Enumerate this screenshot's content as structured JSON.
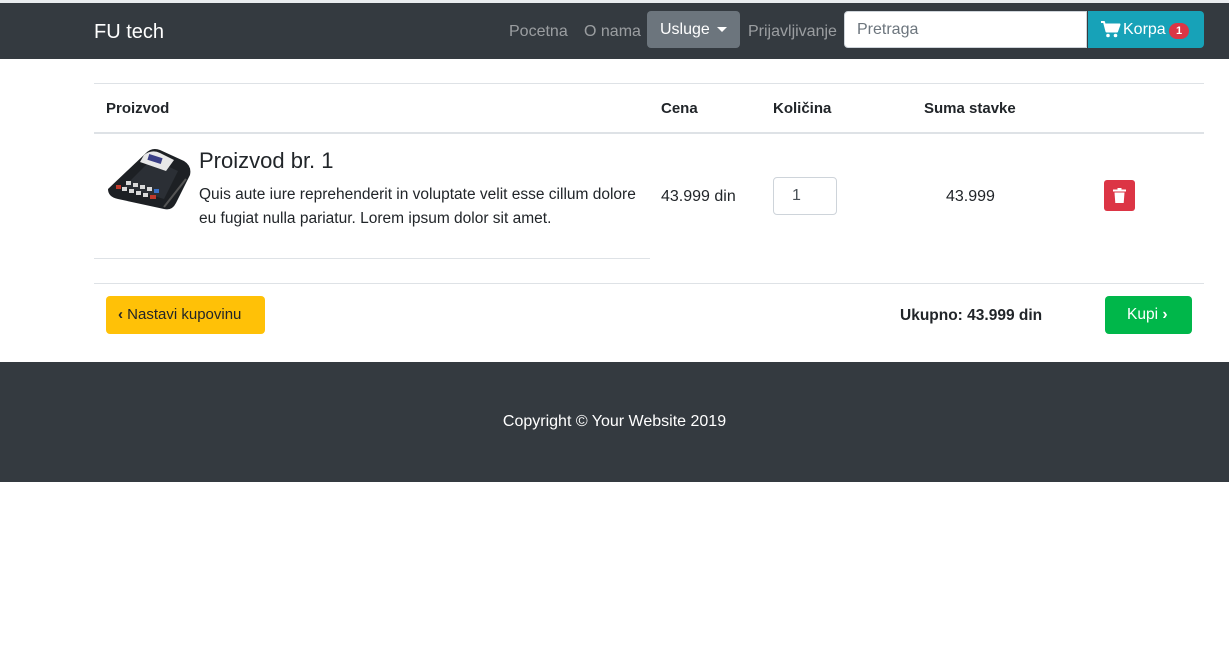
{
  "navbar": {
    "brand": "FU tech",
    "links": [
      "Pocetna",
      "O nama",
      "Usluge",
      "Prijavljivanje"
    ],
    "search_placeholder": "Pretraga",
    "cart_label": "Korpa",
    "cart_count": "1",
    "colors": {
      "bg": "#343a40",
      "dropdown": "#6c757d",
      "cart": "#17a2b8",
      "badge": "#dc3545"
    }
  },
  "table": {
    "headers": [
      "Proizvod",
      "Cena",
      "Količina",
      "Suma stavke"
    ],
    "rows": [
      {
        "title": "Proizvod br. 1",
        "description": "Quis aute iure reprehenderit in voluptate velit esse cillum dolore eu fugiat nulla pariatur. Lorem ipsum dolor sit amet.",
        "price": "43.999 din",
        "quantity": "1",
        "line_total": "43.999",
        "image_icon": "cash-register-image",
        "delete_icon": "trash-icon"
      }
    ]
  },
  "actions": {
    "continue_label": "Nastavi kupovinu",
    "total_label": "Ukupno: 43.999 din",
    "buy_label": "Kupi",
    "colors": {
      "continue": "#ffc107",
      "buy": "#00b74a",
      "delete": "#dc3545"
    }
  },
  "footer": {
    "copyright": "Copyright © Your Website 2019"
  }
}
